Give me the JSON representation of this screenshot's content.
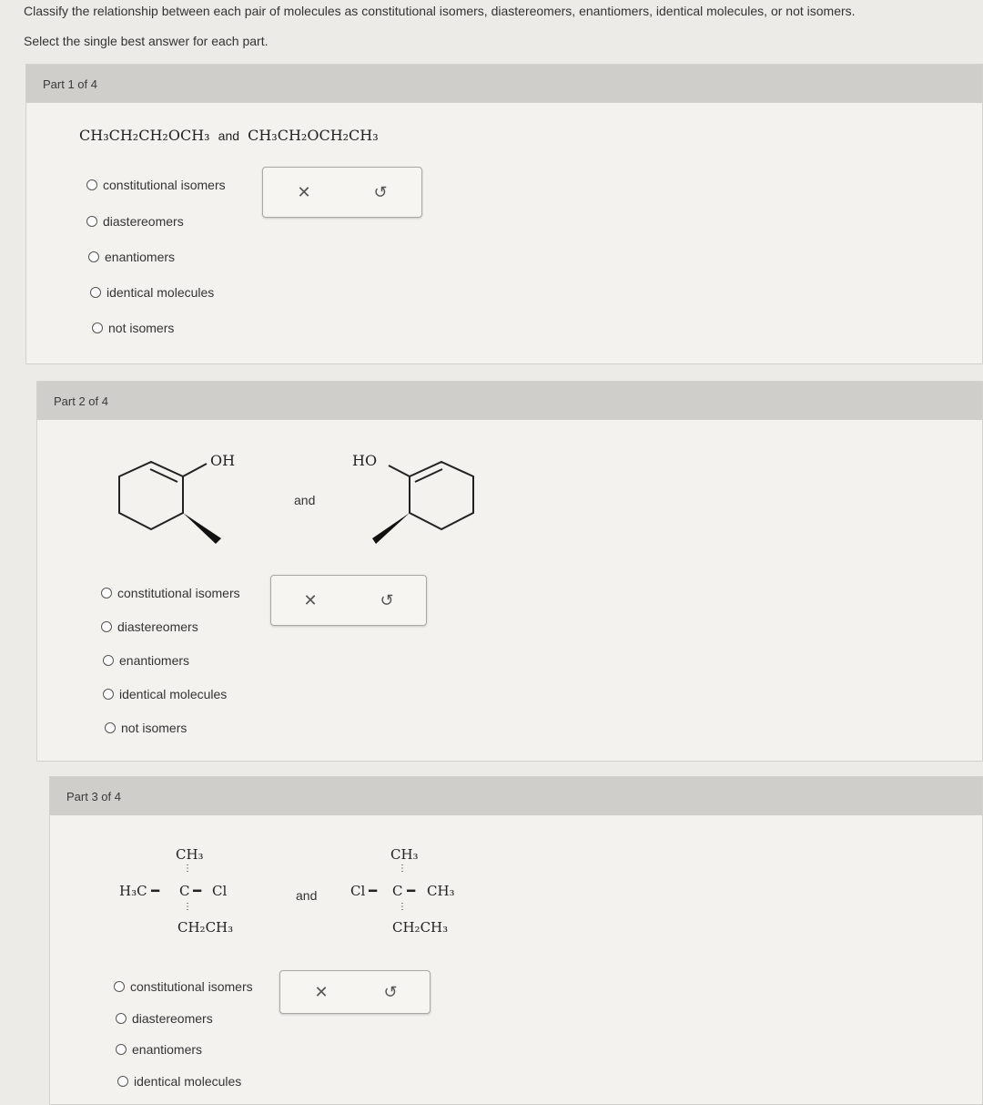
{
  "instructions": {
    "line1": "Classify the relationship between each pair of molecules as constitutional isomers, diastereomers, enantiomers, identical molecules, or not isomers.",
    "line2": "Select the single best answer for each part."
  },
  "options": [
    "constitutional isomers",
    "diastereomers",
    "enantiomers",
    "identical molecules",
    "not isomers"
  ],
  "actions": {
    "clear_icon": "x-icon",
    "undo_icon": "undo-icon"
  },
  "part1": {
    "label": "Part 1 of 4",
    "molecule_a": "CH₃CH₂CH₂OCH₃",
    "connector": "and",
    "molecule_b": "CH₃CH₂OCH₂CH₃"
  },
  "part2": {
    "label": "Part 2 of 4",
    "molecule_a_group": "OH",
    "connector": "and",
    "molecule_b_group": "HO"
  },
  "part3": {
    "label": "Part 3 of 4",
    "connector": "and",
    "molecule_a": {
      "top": "CH₃",
      "left": "H₃C",
      "center": "C",
      "right": "Cl",
      "bottom": "CH₂CH₃"
    },
    "molecule_b": {
      "top": "CH₃",
      "left": "Cl",
      "center": "C",
      "right": "CH₃",
      "bottom": "CH₂CH₃"
    }
  }
}
